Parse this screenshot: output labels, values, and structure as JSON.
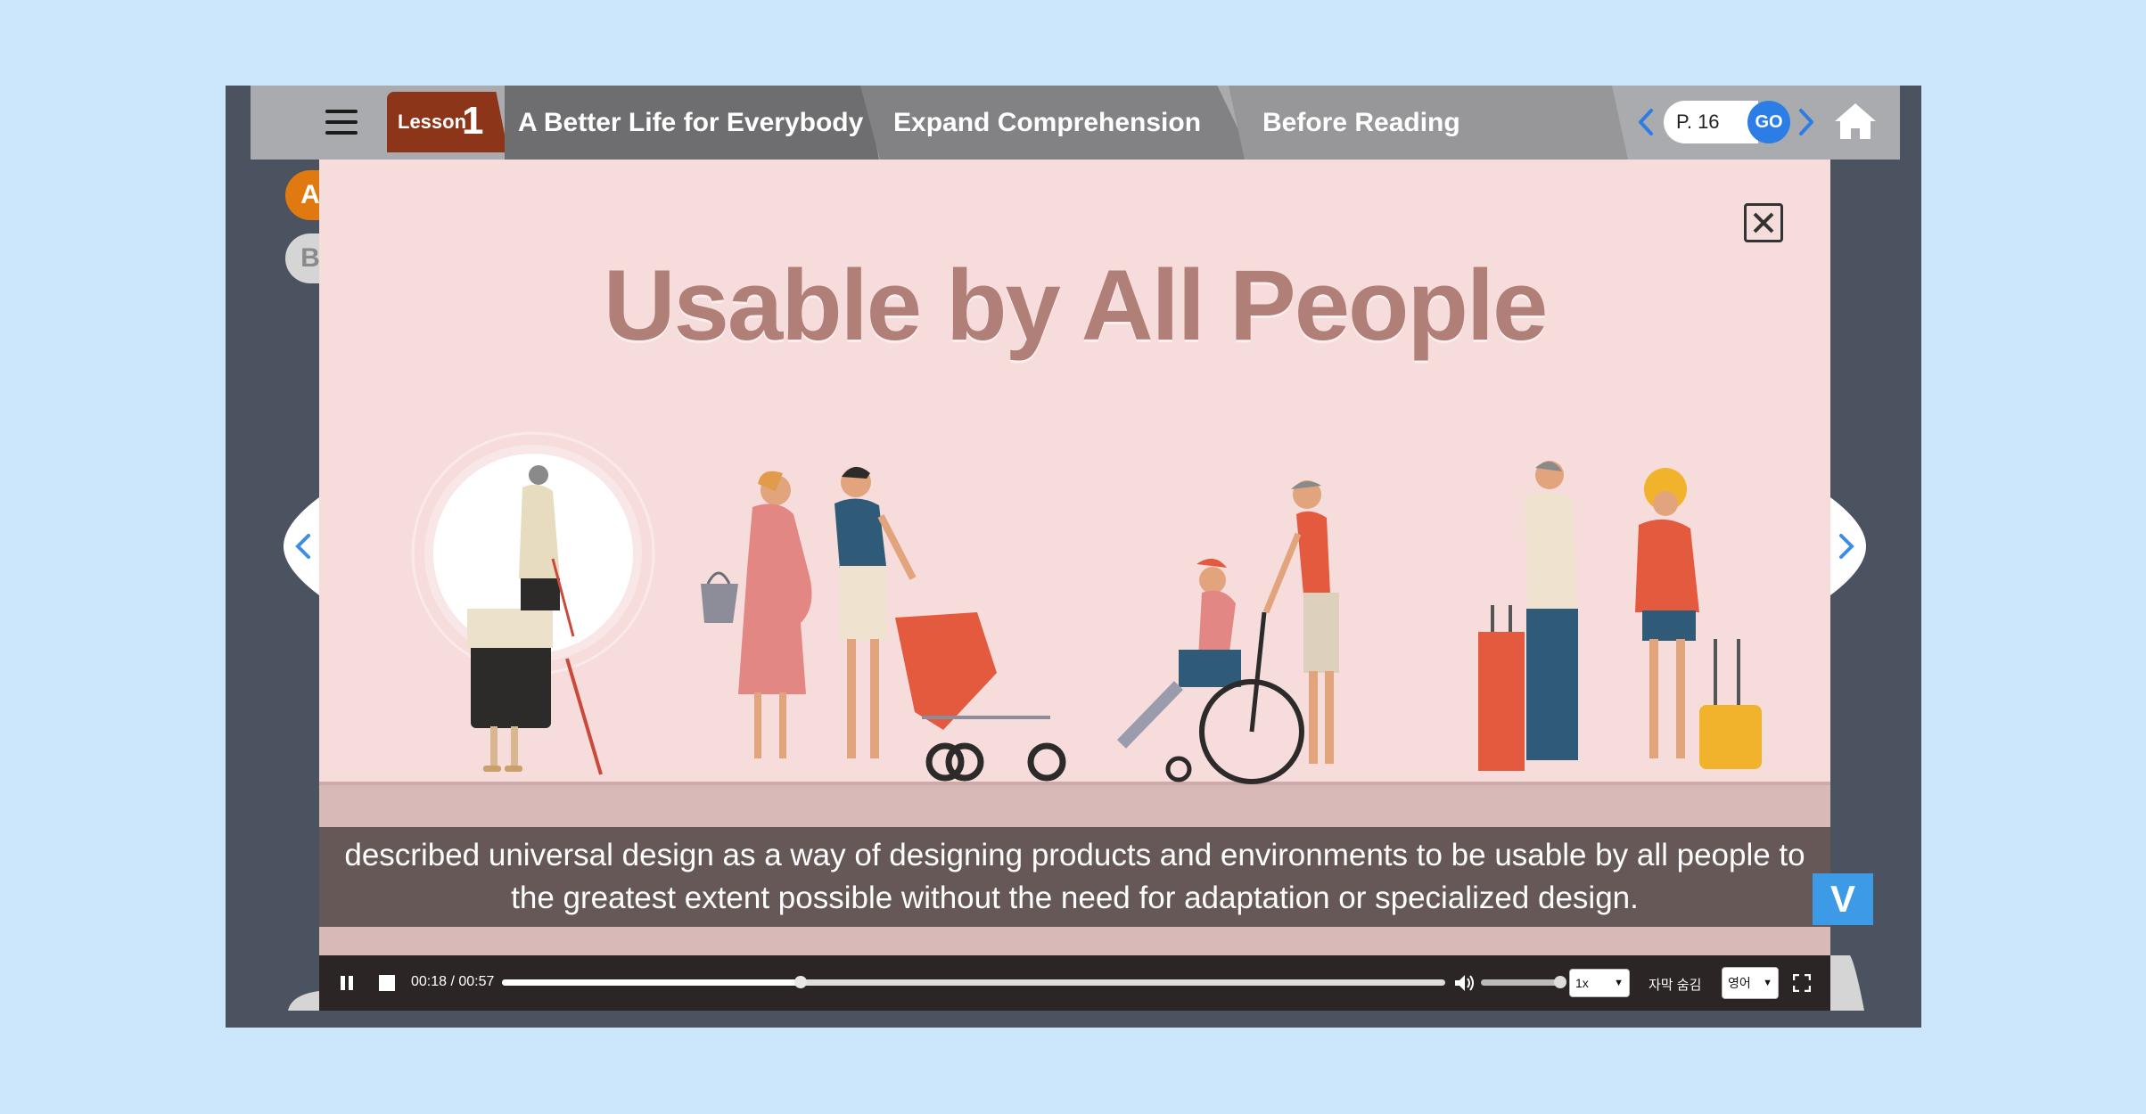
{
  "header": {
    "lesson_word": "Lesson",
    "lesson_number": "1",
    "breadcrumbs": [
      "A Better Life for Everybody",
      "Expand Comprehension",
      "Before Reading"
    ],
    "page_input_value": "P. 16",
    "go_label": "GO"
  },
  "side_tabs": [
    "A",
    "B"
  ],
  "slide": {
    "title": "Usable by All People",
    "subtitle_line1": "described universal design as a way of designing products and environments to be usable by all people to",
    "subtitle_line2": "the greatest extent possible without the need for adaptation or specialized design.",
    "v_label": "V"
  },
  "player": {
    "time": "00:18 / 00:57",
    "progress_fraction": 0.317,
    "speed": "1x",
    "hide_subtitles_label": "자막 숨김",
    "language": "영어"
  },
  "colors": {
    "background": "#cce6fb",
    "lesson_badge": "#8c3518",
    "accent_blue": "#2d7de6",
    "title_color": "#b07f77",
    "tab_a": "#e07a10",
    "tab_b": "#d5d5d5",
    "slide_background": "#f7dcdc"
  }
}
